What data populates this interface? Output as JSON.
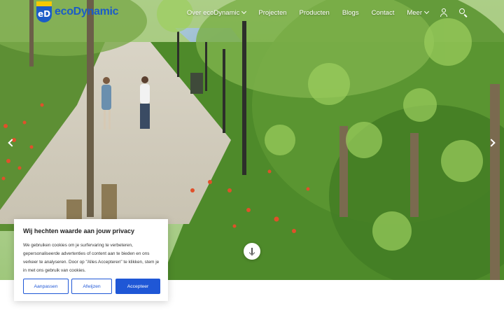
{
  "brand": {
    "mark_text": "eD",
    "name": "ecoDynamic"
  },
  "nav": {
    "items": [
      {
        "label": "Over ecoDynamic",
        "dropdown": true
      },
      {
        "label": "Projecten",
        "dropdown": false
      },
      {
        "label": "Producten",
        "dropdown": false
      },
      {
        "label": "Blogs",
        "dropdown": false
      },
      {
        "label": "Contact",
        "dropdown": false
      },
      {
        "label": "Meer",
        "dropdown": true
      }
    ],
    "icons": [
      "user-icon",
      "search-icon"
    ]
  },
  "hero": {
    "arrows": [
      "arrow-left-icon",
      "arrow-right-icon"
    ],
    "scroll_icon": "arrow-down-icon"
  },
  "cookie": {
    "title": "Wij hechten waarde aan jouw privacy",
    "text": "We gebruiken cookies om je surfervaring te verbeteren, gepersonaliseerde advertenties of content aan te bieden en ons verkeer te analyseren. Door op \"Alles Accepteren\" te klikken, stem je in met ons gebruik van cookies.",
    "buttons": {
      "customize": "Aanpassen",
      "reject": "Afwijzen",
      "accept": "Accepteer"
    }
  },
  "colors": {
    "brand_blue": "#1b5cc7",
    "brand_yellow": "#f6c900",
    "button_blue": "#1f57d6"
  }
}
